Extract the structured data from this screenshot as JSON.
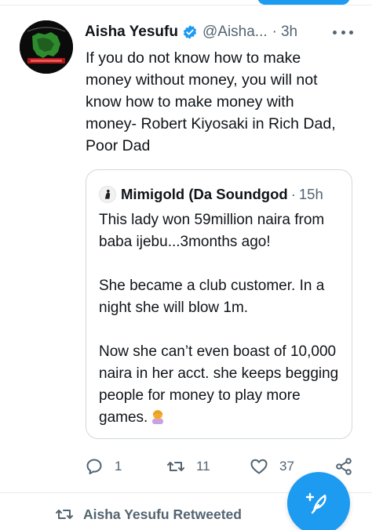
{
  "colors": {
    "accent": "#1d9bf0",
    "text_primary": "#0f1419",
    "text_secondary": "#536471",
    "border": "#cfd9de",
    "emoji_skin": "#f7b33b",
    "emoji_shirt": "#c8a0e8"
  },
  "tweet": {
    "author_name": "Aisha Yesufu",
    "verified": true,
    "handle": "@Aisha...",
    "separator": "·",
    "time": "3h",
    "text": "If you do not know how to make\nmoney without money, you will not\nknow how to make money with\nmoney- Robert Kiyosaki in Rich Dad,\nPoor Dad",
    "avatar_icon": "avatar-image",
    "more_icon": "more-dots-icon"
  },
  "quoted_tweet": {
    "author_name": "Mimigold (Da Soundgod",
    "separator": "·",
    "time": "15h",
    "paragraphs": [
      "This lady won 59million naira from baba ijebu...3months ago!",
      "She became a club customer. In a night she will blow 1m.",
      "Now she can’t even boast of 10,000 naira in her acct. she keeps begging people for money to play more games."
    ],
    "emoji_icon": "facepalm-emoji-icon"
  },
  "actions": {
    "reply_count": "1",
    "retweet_count": "11",
    "like_count": "37"
  },
  "retweet_notice": {
    "label": "Aisha Yesufu Retweeted"
  },
  "compose_button": {
    "icon": "compose-feather-icon"
  }
}
